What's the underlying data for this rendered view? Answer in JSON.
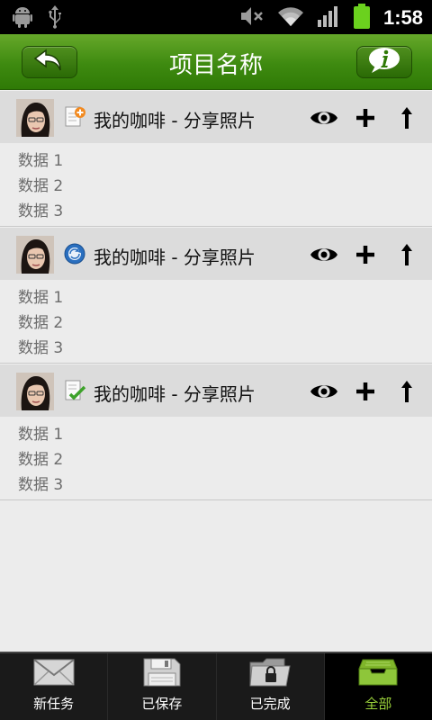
{
  "status_bar": {
    "time": "1:58",
    "icons": [
      "android-icon",
      "usb-icon",
      "mute-icon",
      "wifi-icon",
      "signal-icon",
      "battery-icon"
    ]
  },
  "header": {
    "title": "项目名称",
    "back_icon": "back-arrow-icon",
    "info_icon": "info-icon",
    "color": "#3e8a10"
  },
  "items": [
    {
      "title": "我的咖啡 - 分享照片",
      "type_icon": "document-add-icon",
      "lines": [
        "数据 1",
        "数据 2",
        "数据 3"
      ]
    },
    {
      "title": "我的咖啡 - 分享照片",
      "type_icon": "sync-circle-icon",
      "lines": [
        "数据 1",
        "数据 2",
        "数据 3"
      ]
    },
    {
      "title": "我的咖啡 - 分享照片",
      "type_icon": "document-check-icon",
      "lines": [
        "数据 1",
        "数据 2",
        "数据 3"
      ]
    }
  ],
  "tabs": [
    {
      "label": "新任务",
      "icon": "envelope-icon",
      "active": false
    },
    {
      "label": "已保存",
      "icon": "floppy-disk-icon",
      "active": false
    },
    {
      "label": "已完成",
      "icon": "locked-folder-icon",
      "active": false
    },
    {
      "label": "全部",
      "icon": "inbox-tray-icon",
      "active": true
    }
  ],
  "colors": {
    "active_tab_label": "#9ad13a",
    "tab_bar": "#1a1a1a"
  }
}
